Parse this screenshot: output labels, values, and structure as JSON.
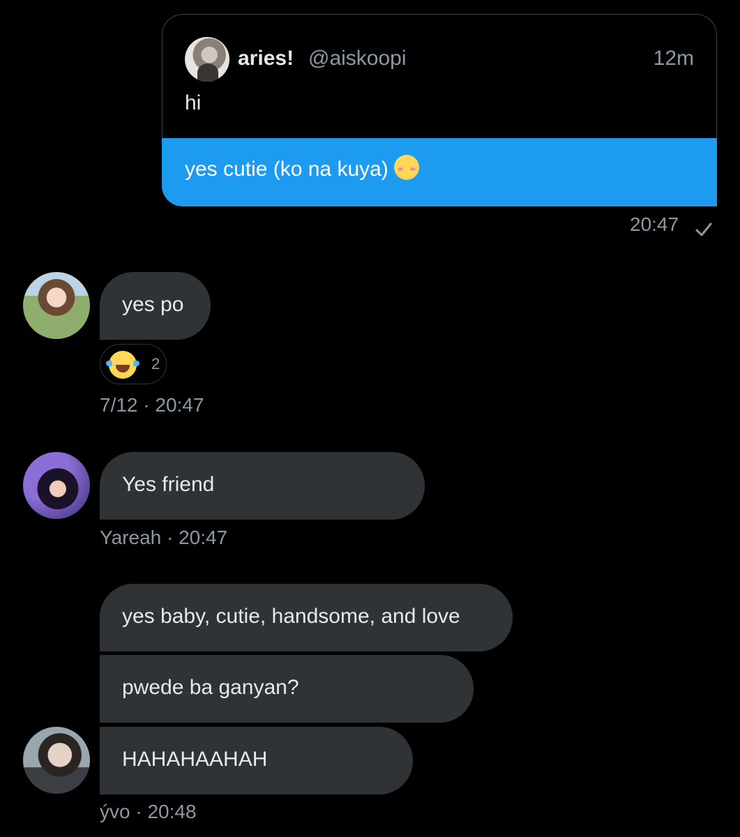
{
  "outgoing": {
    "quote": {
      "name": "aries!",
      "handle": "@aiskoopi",
      "time": "12m",
      "text": "hi"
    },
    "message": "yes cutie (ko na kuya)",
    "message_emoji": "smiling-blush-emoji",
    "timestamp": "20:47",
    "status_icon": "check-icon"
  },
  "incoming": [
    {
      "messages": [
        "yes po"
      ],
      "reaction": {
        "emoji": "tears-of-joy-emoji",
        "count": "2"
      },
      "meta": "7/12 · 20:47"
    },
    {
      "messages": [
        "Yes friend"
      ],
      "meta": "Yareah · 20:47"
    },
    {
      "messages": [
        "yes baby, cutie, handsome, and love",
        "pwede ba ganyan?",
        "HAHAHAAHAH"
      ],
      "meta": "ývo · 20:48"
    }
  ],
  "colors": {
    "background": "#000000",
    "outgoing_bubble": "#1d9bf0",
    "incoming_bubble": "#2f3336",
    "secondary_text": "#8b98a5",
    "primary_text": "#e7e9ea"
  }
}
